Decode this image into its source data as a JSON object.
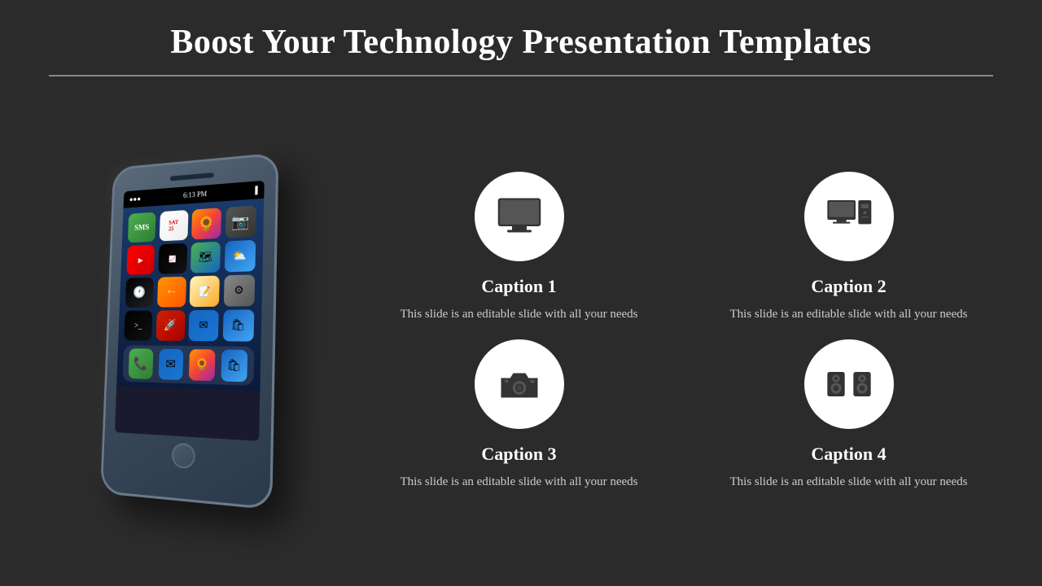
{
  "header": {
    "title": "Boost Your Technology Presentation Templates"
  },
  "captions": [
    {
      "id": "caption-1",
      "title": "Caption 1",
      "text": "This slide is an editable slide with all your needs",
      "icon": "monitor"
    },
    {
      "id": "caption-2",
      "title": "Caption 2",
      "text": "This slide is an editable slide with all your needs",
      "icon": "desktop-tower"
    },
    {
      "id": "caption-3",
      "title": "Caption 3",
      "text": "This slide is an editable slide with all your needs",
      "icon": "camera"
    },
    {
      "id": "caption-4",
      "title": "Caption 4",
      "text": "This slide is an editable slide with all your needs",
      "icon": "speakers"
    }
  ],
  "phone": {
    "time": "6:13 PM"
  }
}
